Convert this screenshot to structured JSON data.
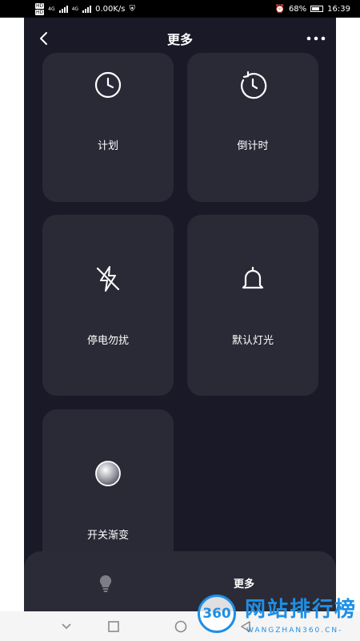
{
  "status_bar": {
    "hd1": "HD",
    "hd2": "HD",
    "net_type": "4G",
    "net_type2": "4G",
    "speed": "0.00K/s",
    "battery_percent": "68%",
    "time": "16:39"
  },
  "header": {
    "title": "更多"
  },
  "cards": [
    {
      "label": "计划",
      "icon": "clock-icon"
    },
    {
      "label": "倒计时",
      "icon": "countdown-icon"
    },
    {
      "label": "停电勿扰",
      "icon": "no-power-icon"
    },
    {
      "label": "默认灯光",
      "icon": "bell-icon"
    },
    {
      "label": "开关渐变",
      "icon": "gradient-circle-icon"
    }
  ],
  "bottom_bar": {
    "more_label": "更多",
    "bulb_icon": "bulb-icon"
  },
  "watermark": {
    "number": "360",
    "title": "网站排行榜",
    "subtitle": "WANGZHAN360.CN-"
  },
  "colors": {
    "background": "#1a1928",
    "card": "#2a2a37",
    "accent": "#1e8fe6"
  }
}
